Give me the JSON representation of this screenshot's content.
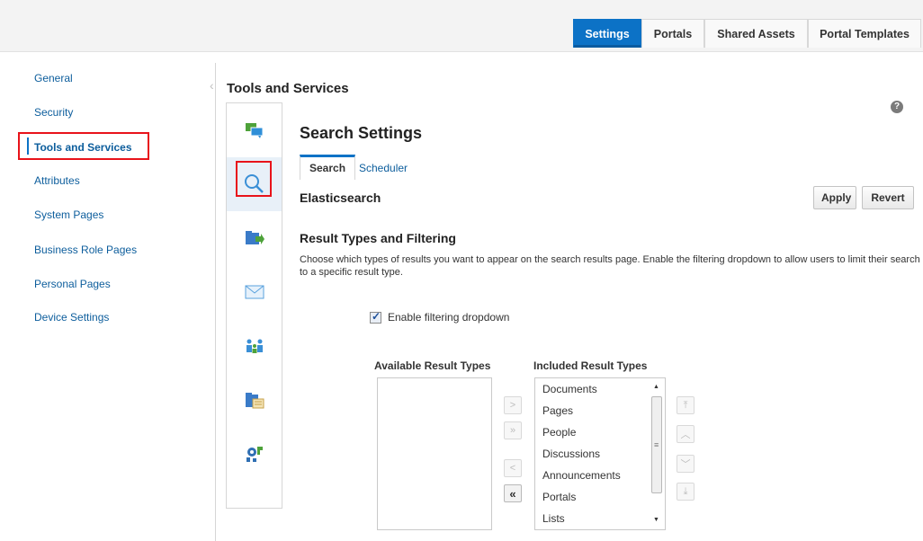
{
  "topnav": {
    "tabs": [
      {
        "label": "Settings",
        "active": true
      },
      {
        "label": "Portals",
        "active": false
      },
      {
        "label": "Shared Assets",
        "active": false
      },
      {
        "label": "Portal Templates",
        "active": false
      }
    ]
  },
  "sidebar": {
    "items": [
      {
        "label": "General"
      },
      {
        "label": "Security"
      },
      {
        "label": "Tools and Services",
        "active": true
      },
      {
        "label": "Attributes"
      },
      {
        "label": "System Pages"
      },
      {
        "label": "Business Role Pages"
      },
      {
        "label": "Personal Pages"
      },
      {
        "label": "Device Settings"
      }
    ]
  },
  "panel": {
    "title": "Tools and Services",
    "rail_icons": [
      "chat-icon",
      "search-icon",
      "folder-export-icon",
      "mail-icon",
      "people-icon",
      "folder-list-icon",
      "settings-puzzle-icon"
    ]
  },
  "search": {
    "heading": "Search Settings",
    "tabs": {
      "search": "Search",
      "scheduler": "Scheduler"
    },
    "engine_heading": "Elasticsearch",
    "apply": "Apply",
    "revert": "Revert",
    "rt_heading": "Result Types and Filtering",
    "description": "Choose which types of results you want to appear on the search results page. Enable the filtering dropdown to allow users to limit their search to a specific result type.",
    "enable_filtering_label": "Enable filtering dropdown",
    "enable_filtering_checked": true,
    "available_heading": "Available Result Types",
    "included_heading": "Included Result Types",
    "included": [
      "Documents",
      "Pages",
      "People",
      "Discussions",
      "Announcements",
      "Portals",
      "Lists"
    ],
    "shuttle": {
      "move": ">",
      "move_all": "»",
      "remove": "<",
      "remove_all": "«"
    },
    "reorder": {
      "top": "⤒",
      "up": "︿",
      "down": "﹀",
      "bottom": "⤓"
    },
    "help": "?"
  }
}
